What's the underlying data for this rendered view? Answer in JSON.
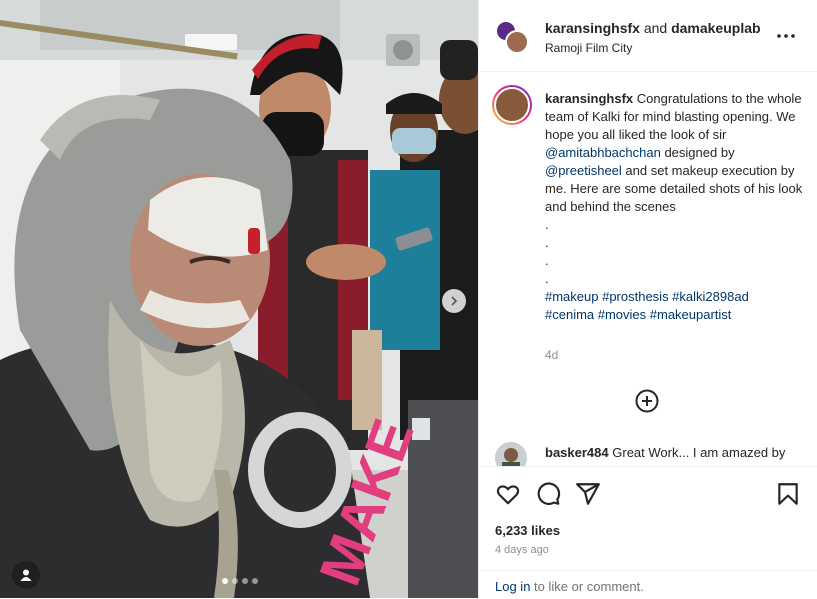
{
  "header": {
    "user_primary": "karansinghsfx",
    "connector": "and",
    "user_secondary": "damakeuplab",
    "location": "Ramoji Film City"
  },
  "caption": {
    "username": "karansinghsfx",
    "text_1": "Congratulations to the whole team of Kalki for mind blasting opening. We hope you all liked the look of sir",
    "mention_1": "@amitabhbachchan",
    "text_2": "designed by",
    "mention_2": "@preetisheel",
    "text_3": "and set makeup execution by me. Here are some detailed shots of his look and behind the scenes",
    "dot_lines": [
      ".",
      ".",
      ".",
      "."
    ],
    "hashtags_line_1": "#makeup #prosthesis #kalki2898ad",
    "hashtags_line_2": "#cenima #movies #makeupartist",
    "time": "4d"
  },
  "comment": {
    "username": "basker484",
    "text": "Great Work... I am amazed by"
  },
  "stats": {
    "likes": "6,233 likes",
    "date": "4 days ago"
  },
  "footer": {
    "login_link": "Log in",
    "login_rest": "to like or comment."
  },
  "media": {
    "apron_text": "MAKE",
    "carousel_total": 4,
    "carousel_active": 1
  },
  "icons": {
    "more": "more-horizontal-icon",
    "load_more": "plus-circle-icon",
    "like": "heart-icon",
    "comment": "comment-icon",
    "share": "share-icon",
    "save": "bookmark-icon",
    "next": "chevron-right-icon",
    "tagged": "user-tag-icon"
  },
  "colors": {
    "link": "#00376b",
    "muted": "#8e8e8e",
    "text": "#262626"
  }
}
